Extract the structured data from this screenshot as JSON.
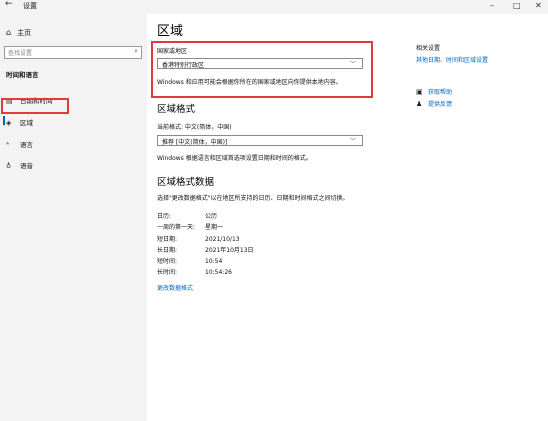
{
  "window": {
    "title": "设置",
    "back_icon": "←",
    "minimize": "–",
    "maximize": "□",
    "close": "✕"
  },
  "sidebar": {
    "home_label": "主页",
    "search_placeholder": "查找设置",
    "section": "时间和语言",
    "items": [
      {
        "icon": "calendar-clock-icon",
        "glyph": "🗓",
        "label": "日期和时间"
      },
      {
        "icon": "globe-icon",
        "glyph": "◈",
        "label": "区域"
      },
      {
        "icon": "language-icon",
        "glyph": "⌘",
        "label": "语言"
      },
      {
        "icon": "microphone-icon",
        "glyph": "🎤",
        "label": "语音"
      }
    ]
  },
  "main": {
    "title": "区域",
    "country": {
      "label": "国家或地区",
      "value": "香港特别行政区",
      "note": "Windows 和应用可能会根据你所在的国家或地区向你提供本地内容。"
    },
    "format": {
      "heading": "区域格式",
      "current_label": "当前格式: 中文(简体，中国)",
      "value": "推荐 [中文(简体，中国)]",
      "note": "Windows 根据语言和区域首选项设置日期和时间的格式。"
    },
    "format_data": {
      "heading": "区域格式数据",
      "note": "选择\"更改数据格式\"以在地区所支持的日历、日期和时间格式之间切换。",
      "rows": [
        {
          "key": "日历:",
          "value": "公历"
        },
        {
          "key": "一周的第一天:",
          "value": "星期一"
        },
        {
          "key": "短日期:",
          "value": "2021/10/13"
        },
        {
          "key": "长日期:",
          "value": "2021年10月13日"
        },
        {
          "key": "短时间:",
          "value": "10:54"
        },
        {
          "key": "长时间:",
          "value": "10:54:26"
        }
      ],
      "change_link": "更改数据格式"
    }
  },
  "right_panel": {
    "heading": "相关设置",
    "related_link": "其他日期、时间和区域设置",
    "help": {
      "icon": "help-chat-icon",
      "glyph": "🗨",
      "label": "获取帮助"
    },
    "feedback": {
      "icon": "feedback-icon",
      "glyph": "✎",
      "label": "提供反馈"
    }
  },
  "colors": {
    "accent": "#0067c0",
    "highlight_border": "#e03a3a",
    "sidebar_bg": "#f3f3f3"
  }
}
